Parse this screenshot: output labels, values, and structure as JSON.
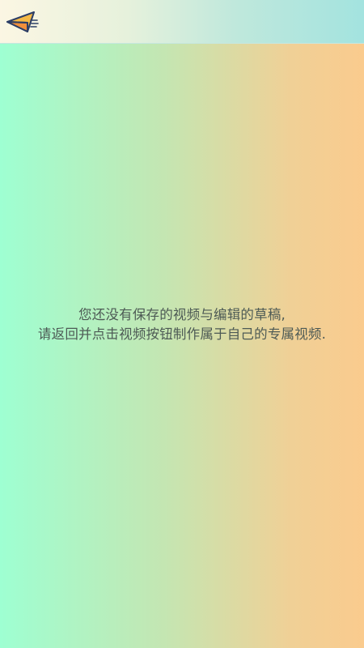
{
  "header": {
    "back_icon": "paper-plane-back-icon"
  },
  "empty_state": {
    "line1": "您还没有保存的视频与编辑的草稿,",
    "line2": "请返回并点击视频按钮制作属于自己的专属视频."
  },
  "colors": {
    "background_left": "#9effd2",
    "background_right": "#facb8e",
    "header_left": "#fbf6e3",
    "header_right": "#a3e3df",
    "icon_fill": "#f5b945",
    "icon_stroke": "#2c3e66",
    "message_text": "#4d5a55"
  }
}
